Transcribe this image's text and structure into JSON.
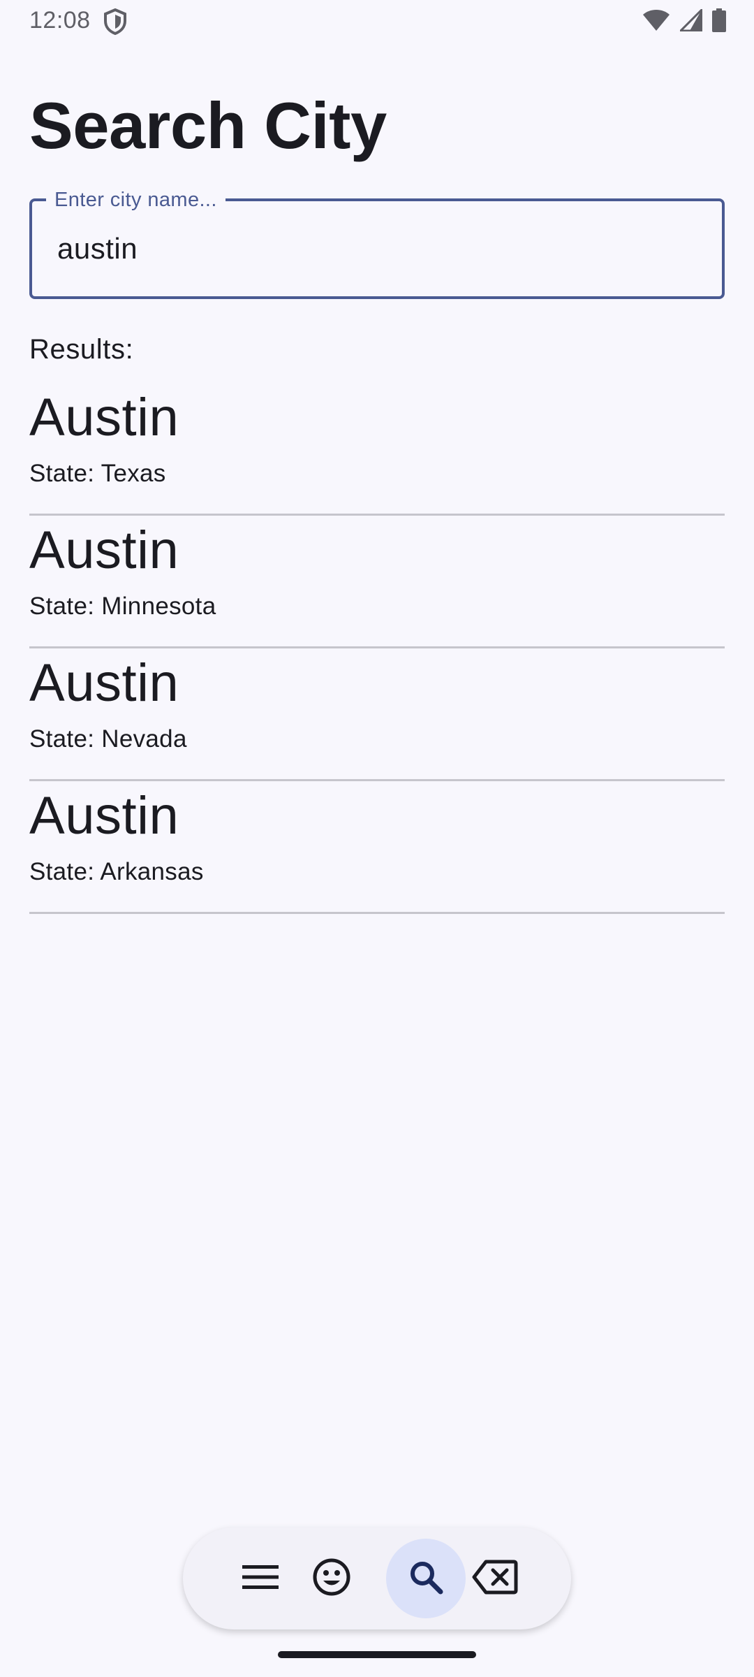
{
  "status_bar": {
    "time": "12:08"
  },
  "page": {
    "title": "Search City"
  },
  "search": {
    "label": "Enter city name...",
    "value": "austin"
  },
  "results": {
    "label": "Results:",
    "items": [
      {
        "city": "Austin",
        "state": "State: Texas"
      },
      {
        "city": "Austin",
        "state": "State: Minnesota"
      },
      {
        "city": "Austin",
        "state": "State: Nevada"
      },
      {
        "city": "Austin",
        "state": "State: Arkansas"
      }
    ]
  },
  "toolbar": {
    "buttons": [
      {
        "icon": "menu-icon",
        "active": false
      },
      {
        "icon": "emoji-icon",
        "active": false
      },
      {
        "icon": "search-icon",
        "active": true
      },
      {
        "icon": "backspace-icon",
        "active": false
      }
    ]
  },
  "colors": {
    "background": "#f8f7fd",
    "accent": "#4a5a92",
    "active_button": "#dbe1f9",
    "divider": "#c6c5cc",
    "text": "#1b1b21"
  }
}
